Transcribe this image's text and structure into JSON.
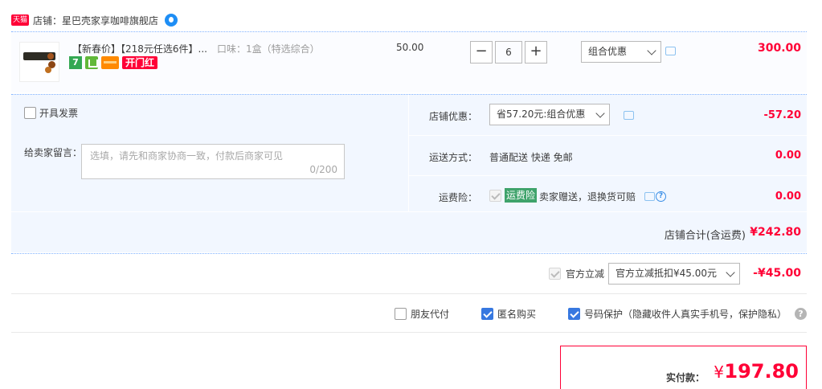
{
  "shop": {
    "badge": "天猫",
    "name": "店铺：星巴壳家享咖啡旗舰店"
  },
  "item": {
    "title": "【新春价】【218元任选6件】...",
    "spec": "口味：1盒（特选综合）",
    "unit_price": "50.00",
    "qty_minus": "−",
    "qty_value": "6",
    "qty_plus": "+",
    "promo": "组合优惠",
    "total": "300.00",
    "tag_seven": "7",
    "tag_hongbao": "开门红"
  },
  "extra": {
    "invoice_label": "开具发票",
    "message_label": "给卖家留言：",
    "message_placeholder": "选填，请先和商家协商一致，付款后商家可见",
    "message_count": "0/200",
    "shop_discount_label": "店铺优惠：",
    "shop_discount_select": "省57.20元:组合优惠",
    "shop_discount_value": "-57.20",
    "shipping_label": "运送方式：",
    "shipping_text": "普通配送 快递 免邮",
    "shipping_value": "0.00",
    "insurance_label": "运费险：",
    "insurance_badge": "运费险",
    "insurance_text": "卖家赠送，退换货可赔",
    "insurance_value": "0.00"
  },
  "shop_total": {
    "label": "店铺合计(含运费)",
    "value": "¥242.80"
  },
  "official": {
    "label": "官方立减",
    "select": "官方立减抵扣¥45.00元",
    "value": "-¥45.00"
  },
  "options": {
    "friend_pay": "朋友代付",
    "anonymous": "匿名购买",
    "number_protect": "号码保护（隐藏收件人真实手机号，保护隐私）",
    "help": "?"
  },
  "payment": {
    "label": "实付款：",
    "currency": "¥",
    "amount": "197.80"
  },
  "colors": {
    "accent_red": "#ff0036",
    "light_blue_bg": "#f2f7ff",
    "checkbox_blue": "#3778e0"
  },
  "icons": [
    "tmall-badge",
    "wangwang-icon",
    "chat-icon",
    "question-icon",
    "help-icon",
    "chevron-down-icon"
  ]
}
